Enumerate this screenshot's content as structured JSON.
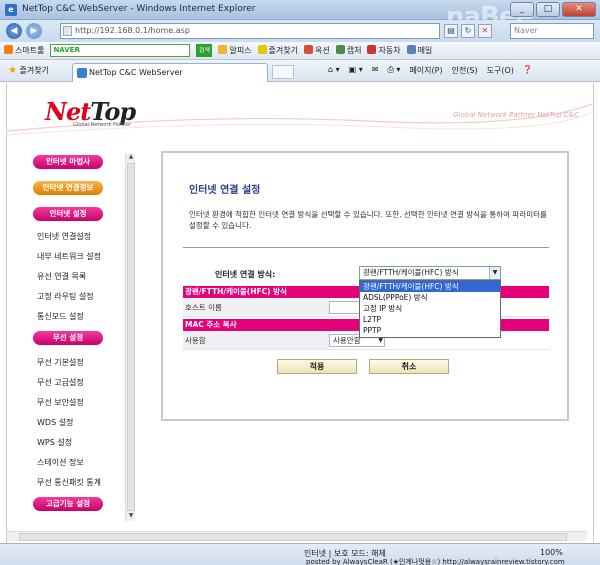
{
  "window": {
    "title": "NetTop C&C WebServer - Windows Internet Explorer",
    "controls": {
      "min": "_",
      "max": "□",
      "close": "✕"
    }
  },
  "address": {
    "url": "http://192.168.0.1/home.asp",
    "search_placeholder": "Naver",
    "watermark": "naBee"
  },
  "toolbar": {
    "smartbar": "스마트툴",
    "naver": "NAVER",
    "search_btn": "검색",
    "items": [
      "알피스",
      "즐겨찾기",
      "옥션",
      "캡처",
      "자동차",
      "메일"
    ]
  },
  "favbar": {
    "favorites": "즐겨찾기",
    "tab_title": "NetTop C&C WebServer",
    "commands": [
      "페이지(P)",
      "안전(S)",
      "도구(O)"
    ]
  },
  "page": {
    "logo_main": "Net",
    "logo_tail": "Top",
    "logo_sub": "Global Network Partner",
    "tagline": "Global Network Partner NetTop C&C"
  },
  "sidebar": {
    "sections": [
      {
        "label": "인터넷 마법사",
        "color": "pink",
        "items": []
      },
      {
        "label": "인터넷 연결정보",
        "color": "orange",
        "items": []
      },
      {
        "label": "인터넷 설정",
        "color": "pink",
        "items": [
          "인터넷 연결설정",
          "내부 네트워크 설정",
          "유선 연결 목록",
          "고정 라우팅 설정",
          "통신모드 설정"
        ]
      },
      {
        "label": "무선 설정",
        "color": "pink",
        "items": [
          "무선 기본설정",
          "무선 고급설정",
          "무선 보안설정",
          "WDS 설정",
          "WPS 설정",
          "스테이션 정보",
          "무선 통신패킷 통계"
        ]
      },
      {
        "label": "고급기능 설정",
        "color": "pink",
        "items": []
      }
    ]
  },
  "main": {
    "title": "인터넷 연결 설정",
    "description": "인터넷 환경에 적합한 인터넷 연결 방식을 선택할 수 있습니다. 또한, 선택한 인터넷 연결 방식을 통하여 파라미터를 설정할 수 있습니다.",
    "connection_label": "인터넷 연결 방식:",
    "connection_value": "광랜/FTTH/케이블(HFC) 방식",
    "options": [
      "광랜/FTTH/케이블(HFC) 방식",
      "ADSL(PPPoE) 방식",
      "고정 IP 방식",
      "L2TP",
      "PPTP"
    ],
    "section1": "광랜/FTTH/케이블(HFC) 방식",
    "hostname_label": "호스트 이름",
    "hostname_value": "",
    "section2": "MAC 주소 복사",
    "use_label": "사용함",
    "use_value": "사용안함",
    "apply": "적용",
    "cancel": "취소"
  },
  "status": {
    "zone": "인터넷 | 보호 모드: 해제",
    "zoom": "100%",
    "credit": "posted by AlwaysCleaR (★인계나멋용☆) http://alwaysrainreview.tistory.com"
  }
}
